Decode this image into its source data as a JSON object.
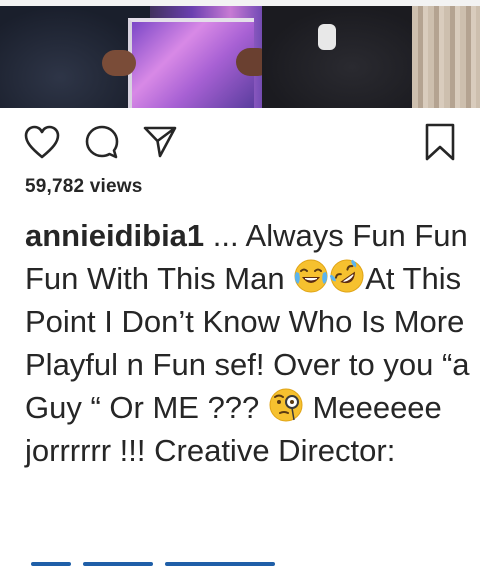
{
  "post": {
    "views_text": "59,782 views",
    "username": "annieidibia1",
    "caption_parts": [
      " ... Always Fun Fun Fun With This Man ",
      "At This Point I Don’t Know Who Is More Playful n Fun sef! Over to you “a Guy “ Or ME ??? ",
      " Meeeeee jorrrrrr !!! Creative Director:"
    ],
    "emojis": [
      "face-with-tears-of-joy",
      "rolling-on-the-floor-laughing",
      "face-with-monocle"
    ]
  },
  "actions": {
    "like_icon": "heart-outline-icon",
    "comment_icon": "comment-bubble-icon",
    "share_icon": "paper-plane-icon",
    "save_icon": "bookmark-outline-icon"
  },
  "colors": {
    "text": "#262626",
    "link": "#1f5fa8",
    "emoji_yellow": "#f6c12f"
  }
}
